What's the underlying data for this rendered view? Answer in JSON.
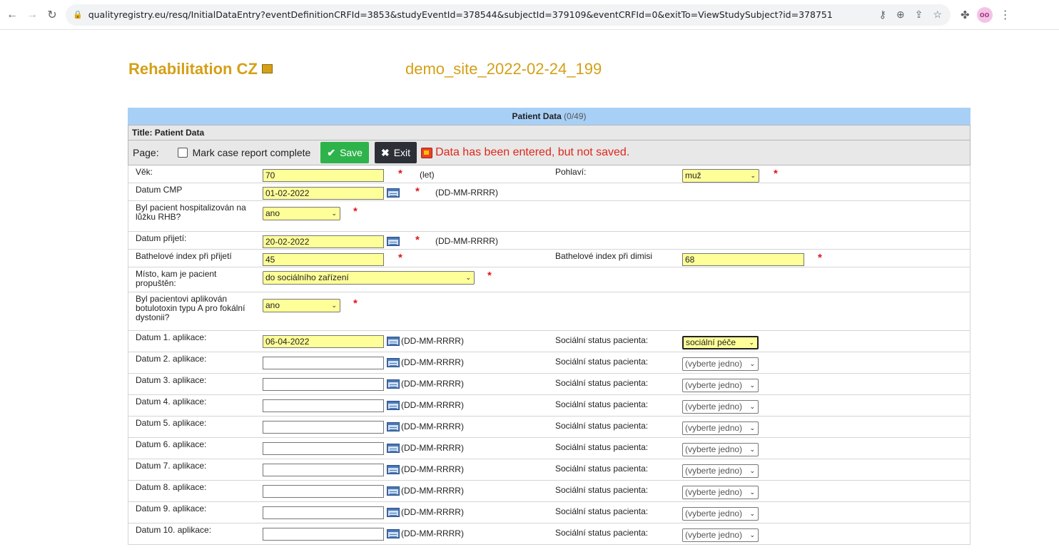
{
  "browser": {
    "url": "qualityregistry.eu/resq/InitialDataEntry?eventDefinitionCRFId=3853&studyEventId=378544&subjectId=379109&eventCRFId=0&exitTo=ViewStudySubject?id=378751"
  },
  "header": {
    "registry_title": "Rehabilitation CZ",
    "site_name": "demo_site_2022-02-24_199"
  },
  "form": {
    "section_title": "Patient Data",
    "section_count": "(0/49)",
    "title_label": "Title: Patient Data",
    "page_label": "Page:",
    "mark_complete_label": "Mark case report complete",
    "save_label": "Save",
    "exit_label": "Exit",
    "warning": "Data has been entered, but not saved.",
    "date_hint": "(DD-MM-RRRR)",
    "required_mark": "*"
  },
  "fields": {
    "age": {
      "label": "Věk:",
      "value": "70",
      "unit": "(let)"
    },
    "sex": {
      "label": "Pohlaví:",
      "value": "muž"
    },
    "stroke_date": {
      "label": "Datum CMP",
      "value": "01-02-2022"
    },
    "hospitalized": {
      "label": "Byl pacient hospitalizován na lůžku RHB?",
      "value": "ano"
    },
    "admission_date": {
      "label": "Datum přijetí:",
      "value": "20-02-2022"
    },
    "barthel_admission": {
      "label": "Bathelové index při přijetí",
      "value": "45"
    },
    "barthel_discharge": {
      "label": "Bathelové index při dimisi",
      "value": "68"
    },
    "discharge_place": {
      "label": "Místo, kam je pacient propuštěn:",
      "value": "do sociálního zařízení"
    },
    "botulotoxin": {
      "label": "Byl pacientovi aplikován botulotoxin typu A pro fokální dystonii?",
      "value": "ano"
    }
  },
  "applications": [
    {
      "label": "Datum 1. aplikace:",
      "value": "06-04-2022",
      "status_label": "Sociální status pacienta:",
      "status": "sociální péče"
    },
    {
      "label": "Datum 2. aplikace:",
      "value": "",
      "status_label": "Sociální status pacienta:",
      "status": "(vyberte jedno)"
    },
    {
      "label": "Datum 3. aplikace:",
      "value": "",
      "status_label": "Sociální status pacienta:",
      "status": "(vyberte jedno)"
    },
    {
      "label": "Datum 4. aplikace:",
      "value": "",
      "status_label": "Sociální status pacienta:",
      "status": "(vyberte jedno)"
    },
    {
      "label": "Datum 5. aplikace:",
      "value": "",
      "status_label": "Sociální status pacienta:",
      "status": "(vyberte jedno)"
    },
    {
      "label": "Datum 6. aplikace:",
      "value": "",
      "status_label": "Sociální status pacienta:",
      "status": "(vyberte jedno)"
    },
    {
      "label": "Datum 7. aplikace:",
      "value": "",
      "status_label": "Sociální status pacienta:",
      "status": "(vyberte jedno)"
    },
    {
      "label": "Datum 8. aplikace:",
      "value": "",
      "status_label": "Sociální status pacienta:",
      "status": "(vyberte jedno)"
    },
    {
      "label": "Datum 9. aplikace:",
      "value": "",
      "status_label": "Sociální status pacienta:",
      "status": "(vyberte jedno)"
    },
    {
      "label": "Datum 10. aplikace:",
      "value": "",
      "status_label": "Sociální status pacienta:",
      "status": "(vyberte jedno)"
    }
  ],
  "colors": {
    "accent_gold": "#d4a017",
    "section_blue": "#a8d0f7",
    "filled_yellow": "#ffff99",
    "save_green": "#2db34a",
    "warning_red": "#e0271a"
  }
}
